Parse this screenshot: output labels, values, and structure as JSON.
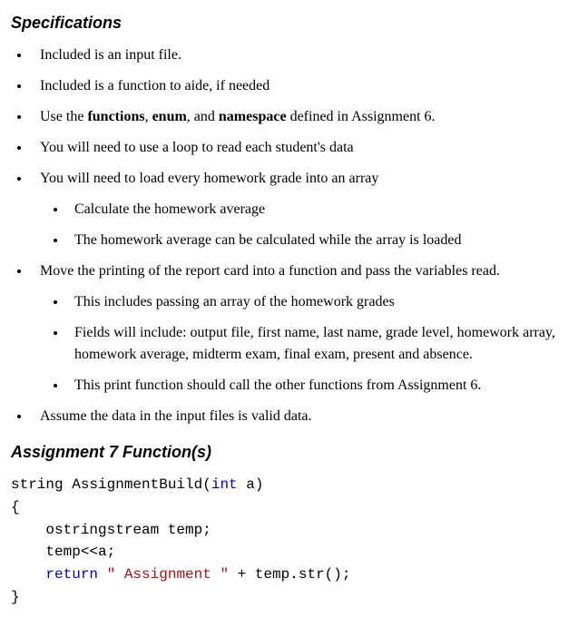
{
  "heading_specs": "Specifications",
  "specs": {
    "i0": "Included is an input file.",
    "i1": "Included is a function to aide, if needed",
    "i2_pre": "Use the ",
    "i2_b1": "functions",
    "i2_sep1": ", ",
    "i2_b2": "enum",
    "i2_sep2": ", and ",
    "i2_b3": "namespace",
    "i2_post": " defined in Assignment 6.",
    "i3": "You will need to use a loop to read each student's data",
    "i4": "You will need to load every homework grade into an array",
    "i4_sub": {
      "s0": "Calculate the homework average",
      "s1": "The homework average can be calculated while the array is loaded"
    },
    "i5": "Move the printing of the report card into a function and pass the variables read.",
    "i5_sub": {
      "s0": "This includes passing an array of the homework grades",
      "s1": "Fields will include: output file, first name, last name, grade level, homework array, homework average, midterm exam, final exam, present and absence.",
      "s2": "This print function should call the other functions from Assignment 6."
    },
    "i6": "Assume the data in the input files is valid data."
  },
  "heading_func": "Assignment 7 Function(s)",
  "code": {
    "sig_pre": "string AssignmentBuild(",
    "sig_type": "int",
    "sig_post": " a)",
    "brace_open": "{",
    "line1": "    ostringstream temp;",
    "line2": "    temp<<a;",
    "ret_indent": "    ",
    "ret_kw": "return",
    "ret_sp": " ",
    "ret_str": "\" Assignment \"",
    "ret_post": " + temp.str();",
    "brace_close": "}"
  }
}
